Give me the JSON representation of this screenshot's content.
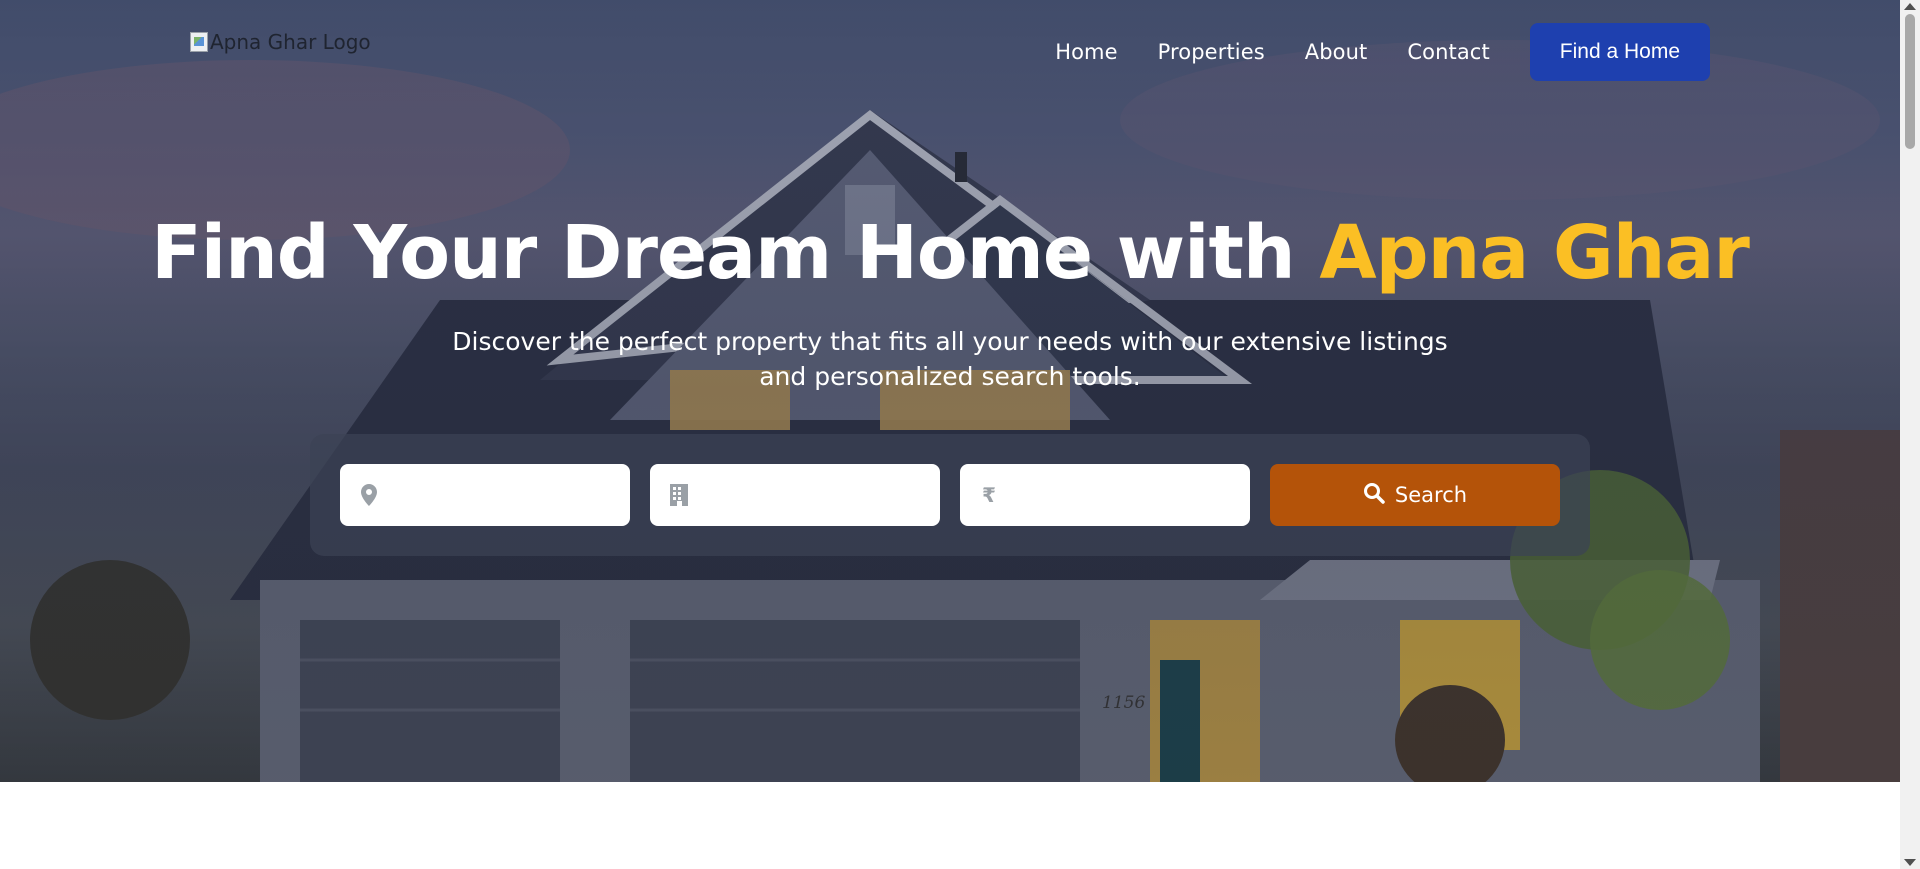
{
  "header": {
    "logo_alt": "Apna Ghar Logo",
    "nav": [
      "Home",
      "Properties",
      "About",
      "Contact"
    ],
    "cta_label": "Find a Home"
  },
  "hero": {
    "title_main": "Find Your Dream Home with ",
    "title_brand": "Apna Ghar",
    "subtitle": "Discover the perfect property that fits all your needs with our extensive listings and personalized search tools.",
    "house_number": "1156"
  },
  "search": {
    "location_value": "",
    "type_value": "",
    "price_value": "",
    "location_icon": "map-marker-icon",
    "type_icon": "building-icon",
    "price_icon": "rupee-icon",
    "price_symbol": "₹",
    "button_icon": "search-icon",
    "button_label": "Search"
  },
  "colors": {
    "accent": "#fbbf24",
    "cta": "#1e40af",
    "search_button": "#b45309"
  }
}
